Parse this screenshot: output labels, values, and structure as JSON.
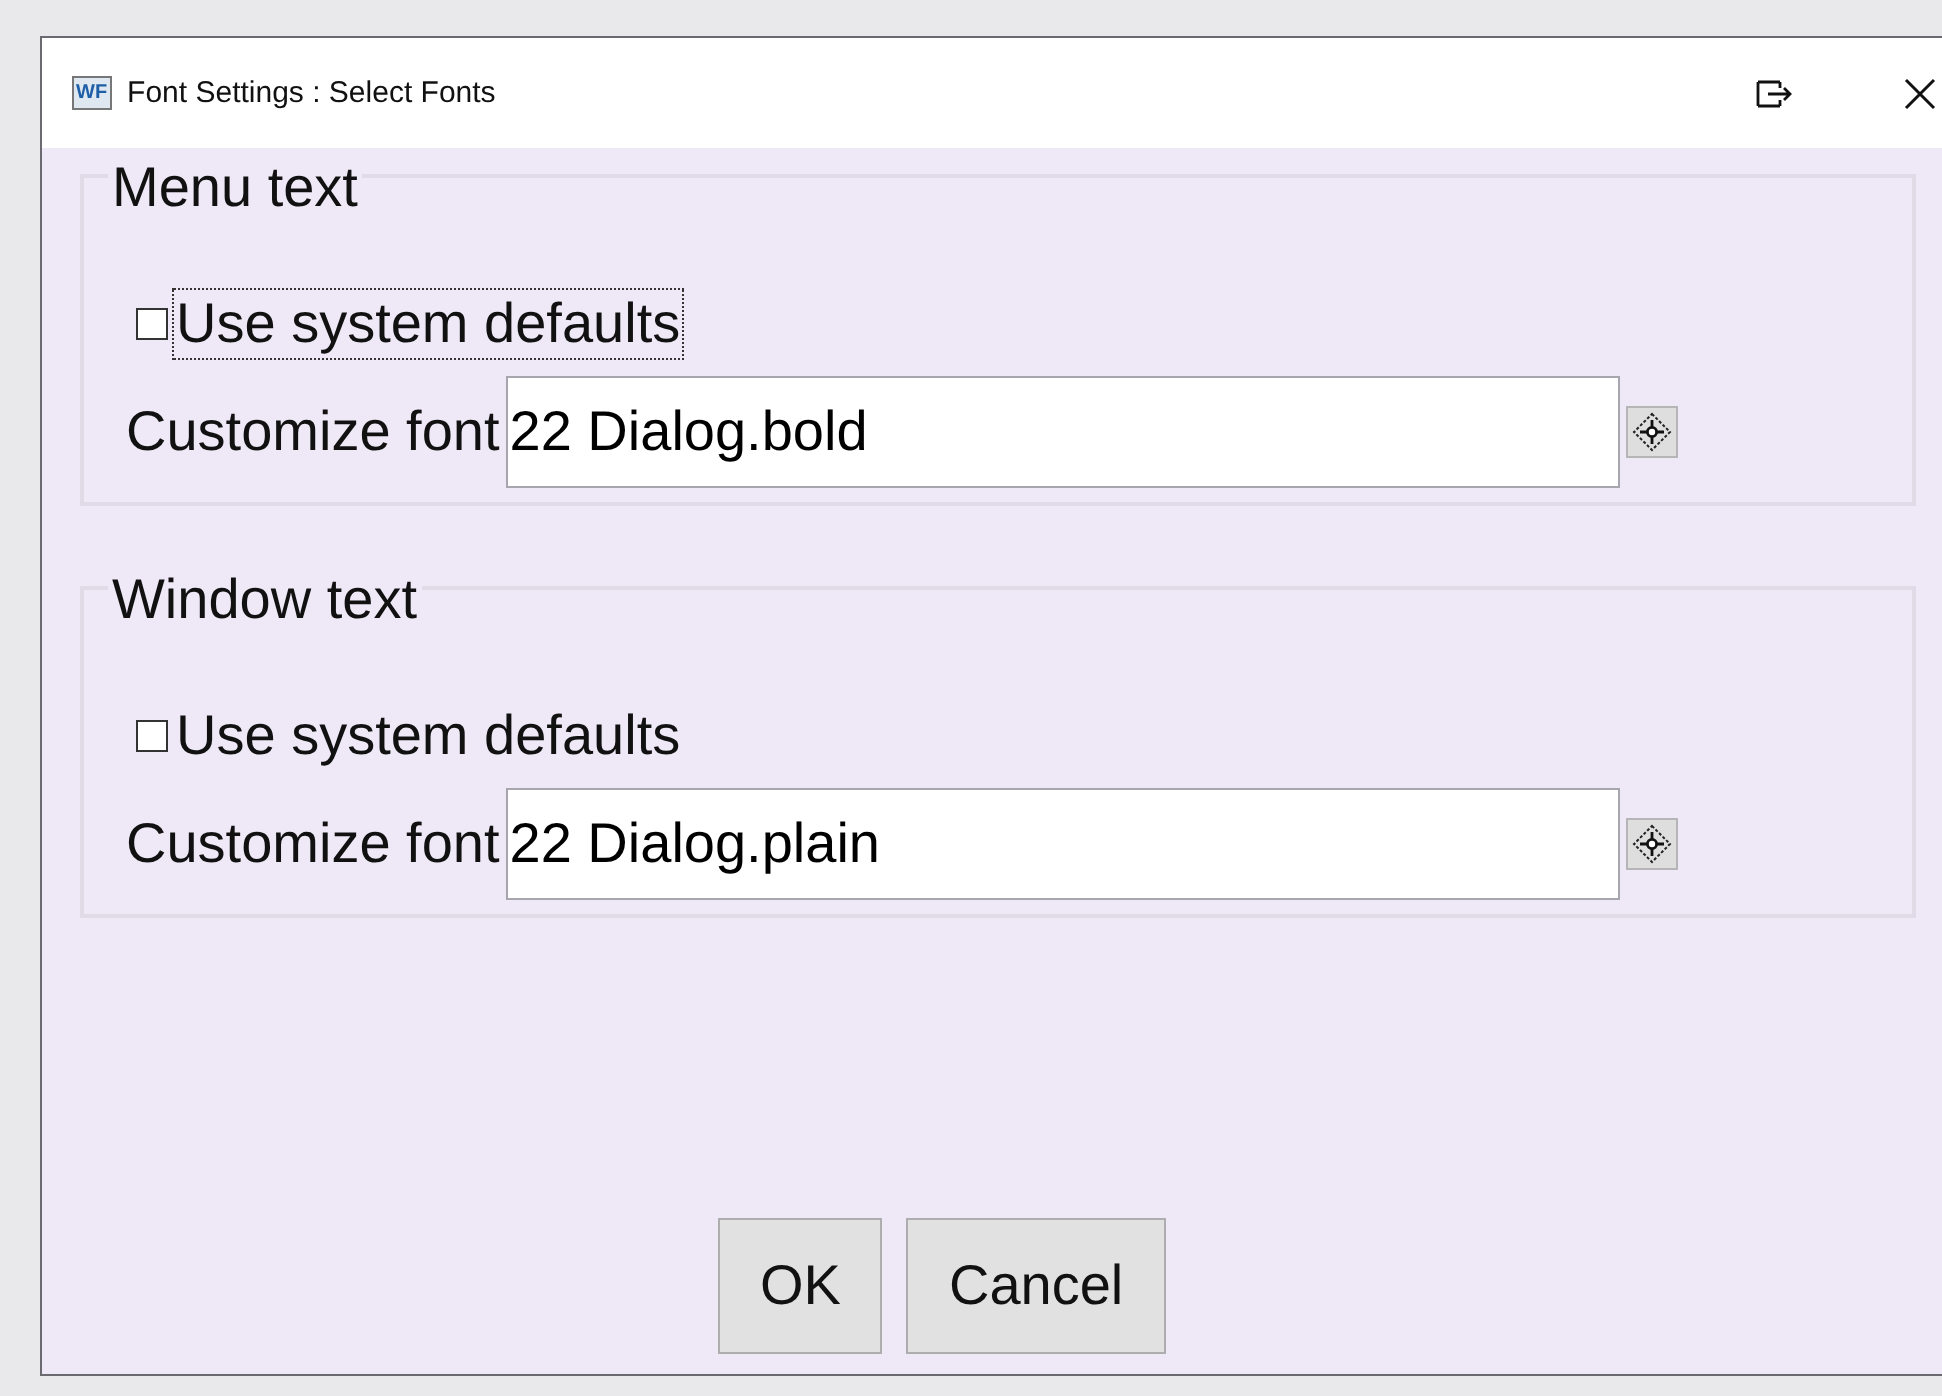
{
  "window": {
    "title": "Font Settings : Select Fonts",
    "app_badge": "WF"
  },
  "groups": [
    {
      "title": "Menu text",
      "use_defaults": {
        "label": "Use system defaults",
        "checked": false,
        "focused": true
      },
      "font_label": "Customize font",
      "font_value": "22 Dialog.bold"
    },
    {
      "title": "Window text",
      "use_defaults": {
        "label": "Use system defaults",
        "checked": false,
        "focused": false
      },
      "font_label": "Customize font",
      "font_value": "22 Dialog.plain"
    }
  ],
  "buttons": [
    "OK",
    "Cancel"
  ]
}
